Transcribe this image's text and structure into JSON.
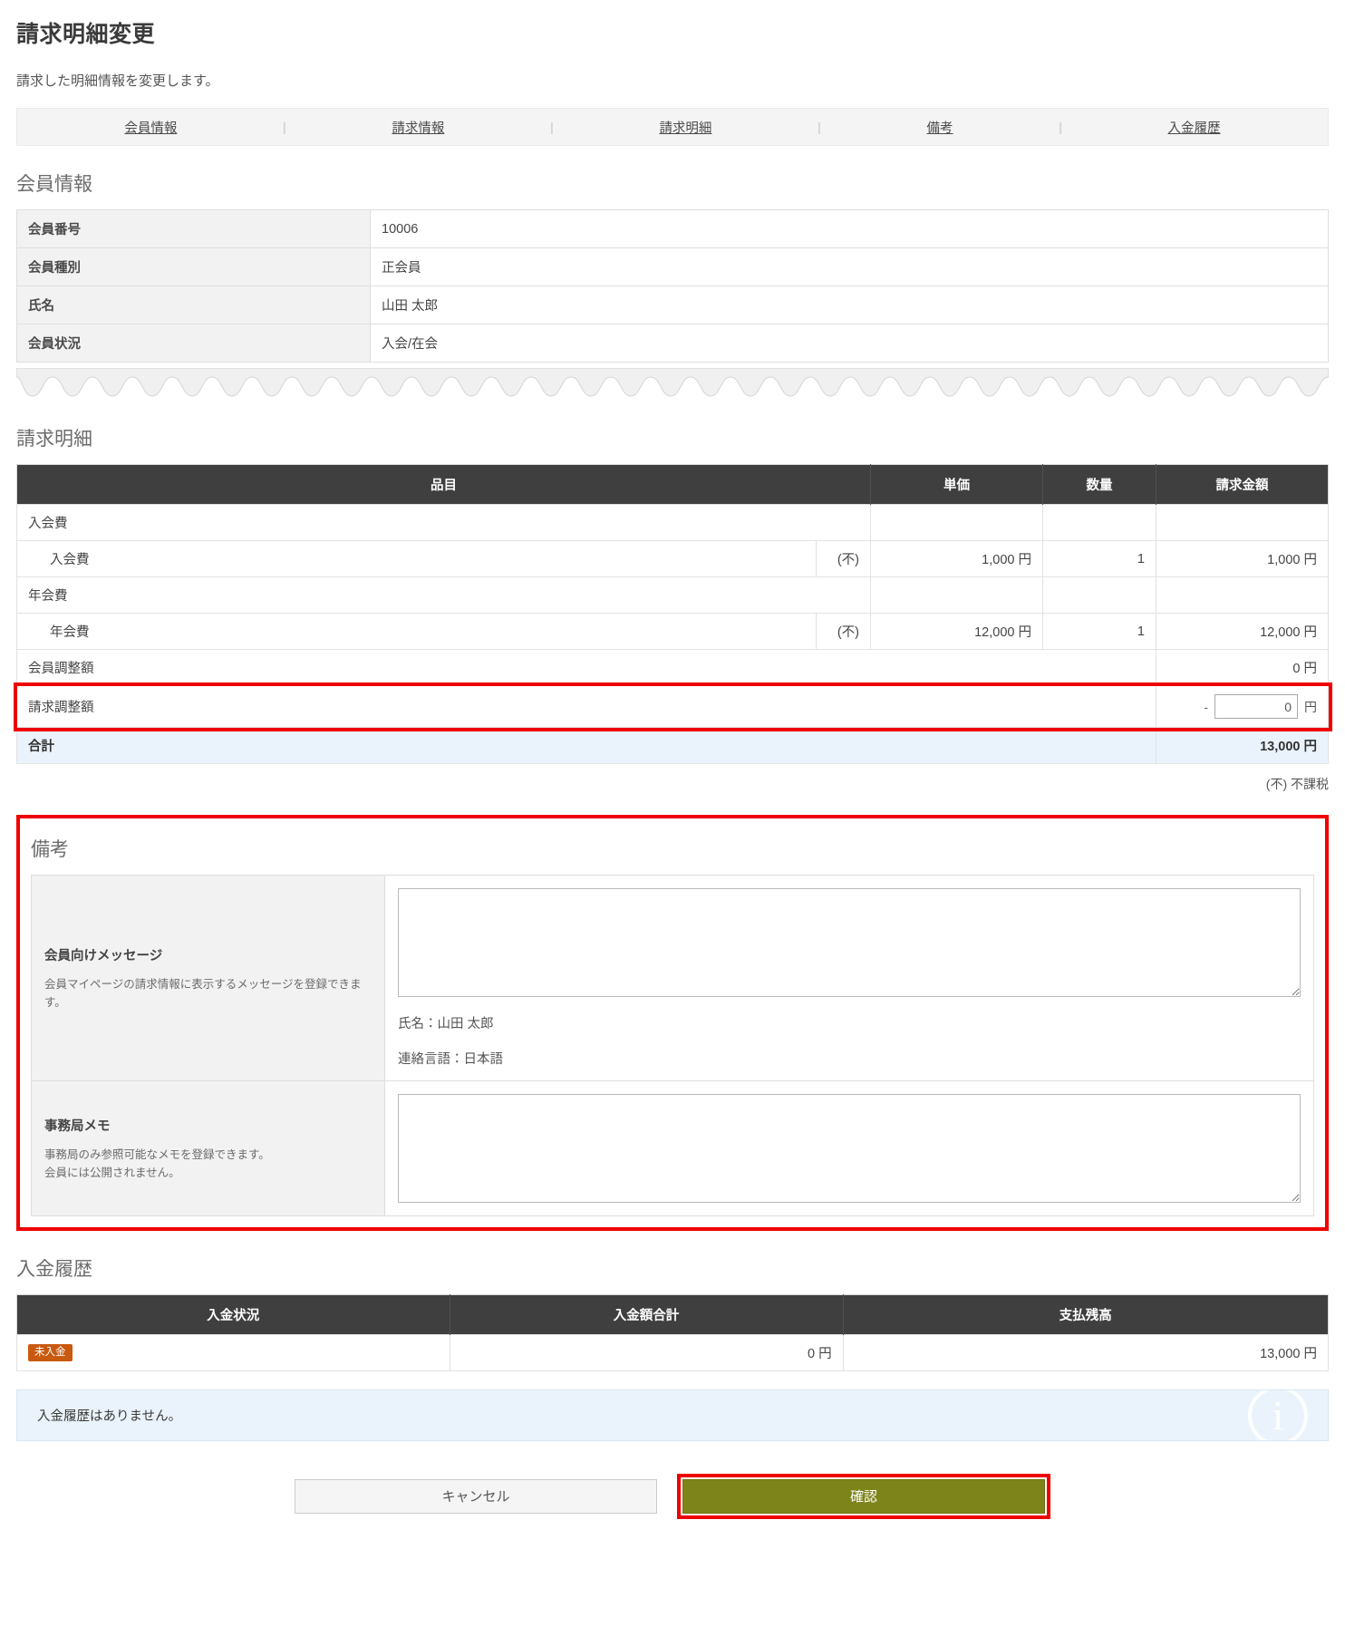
{
  "header": {
    "title": "請求明細変更",
    "description": "請求した明細情報を変更します。"
  },
  "nav": {
    "items": [
      {
        "label": "会員情報"
      },
      {
        "label": "請求情報"
      },
      {
        "label": "請求明細"
      },
      {
        "label": "備考"
      },
      {
        "label": "入金履歴"
      }
    ],
    "separator": "|"
  },
  "member_section": {
    "title": "会員情報",
    "rows": [
      {
        "key": "会員番号",
        "value": "10006"
      },
      {
        "key": "会員種別",
        "value": "正会員"
      },
      {
        "key": "氏名",
        "value": "山田 太郎"
      },
      {
        "key": "会員状況",
        "value": "入会/在会"
      }
    ]
  },
  "detail_section": {
    "title": "請求明細",
    "columns": [
      "品目",
      "単価",
      "数量",
      "請求金額"
    ],
    "rows": [
      {
        "type": "group",
        "item": "入会費",
        "tax": "",
        "unit_price": "",
        "qty": "",
        "amount": ""
      },
      {
        "type": "child",
        "item": "入会費",
        "tax": "(不)",
        "unit_price": "1,000 円",
        "qty": "1",
        "amount": "1,000 円"
      },
      {
        "type": "group",
        "item": "年会費",
        "tax": "",
        "unit_price": "",
        "qty": "",
        "amount": ""
      },
      {
        "type": "child",
        "item": "年会費",
        "tax": "(不)",
        "unit_price": "12,000 円",
        "qty": "1",
        "amount": "12,000 円"
      },
      {
        "type": "adjust_readonly",
        "item": "会員調整額",
        "tax": "",
        "unit_price": "",
        "qty": "",
        "amount": "0 円"
      }
    ],
    "billing_adjust": {
      "label": "請求調整額",
      "minus_sign": "-",
      "input_value": "0",
      "unit": "円"
    },
    "total": {
      "label": "合計",
      "amount": "13,000 円"
    },
    "tax_note": "(不) 不課税"
  },
  "remarks_section": {
    "title": "備考",
    "member_message": {
      "label": "会員向けメッセージ",
      "description": "会員マイページの請求情報に表示するメッセージを登録できます。",
      "value": "",
      "meta": [
        "氏名：山田 太郎",
        "連絡言語：日本語"
      ]
    },
    "office_memo": {
      "label": "事務局メモ",
      "description_line1": "事務局のみ参照可能なメモを登録できます。",
      "description_line2": "会員には公開されません。",
      "value": ""
    }
  },
  "payment_section": {
    "title": "入金履歴",
    "columns": [
      "入金状況",
      "入金額合計",
      "支払残高"
    ],
    "row": {
      "status_badge": "未入金",
      "total_paid": "0 円",
      "balance": "13,000 円"
    },
    "empty_message": "入金履歴はありません。",
    "info_icon": "i"
  },
  "footer": {
    "cancel_label": "キャンセル",
    "confirm_label": "確認"
  },
  "colors": {
    "highlight": "#ee0000",
    "confirm_button": "#7d8419",
    "badge_unpaid": "#c85a10",
    "balance_red": "#d0021b",
    "table_header": "#3f3f3f",
    "total_row_bg": "#eaf3fb"
  }
}
